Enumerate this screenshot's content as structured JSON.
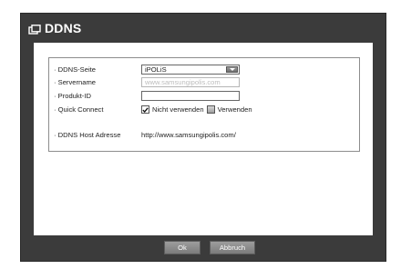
{
  "dialog": {
    "title": "DDNS"
  },
  "fields": {
    "site": {
      "label": "· DDNS-Seite",
      "value": "iPOLiS"
    },
    "server": {
      "label": "· Servername",
      "placeholder": "www.samsungipolis.com"
    },
    "product": {
      "label": "· Produkt-ID",
      "value": ""
    },
    "quick": {
      "label": "· Quick Connect",
      "option_off": "Nicht verwenden",
      "option_on": "Verwenden",
      "selected": "Nicht verwenden"
    },
    "host": {
      "label": "· DDNS Host Adresse",
      "value": "http://www.samsungipolis.com/"
    }
  },
  "buttons": {
    "ok": "Ok",
    "cancel": "Abbruch"
  },
  "icons": {
    "title_icon": "window-icon",
    "dropdown": "chevron-down-icon",
    "check": "check-icon"
  },
  "colors": {
    "frame": "#3b3b3b",
    "panel": "#ffffff",
    "button": "#8a8a8a"
  }
}
